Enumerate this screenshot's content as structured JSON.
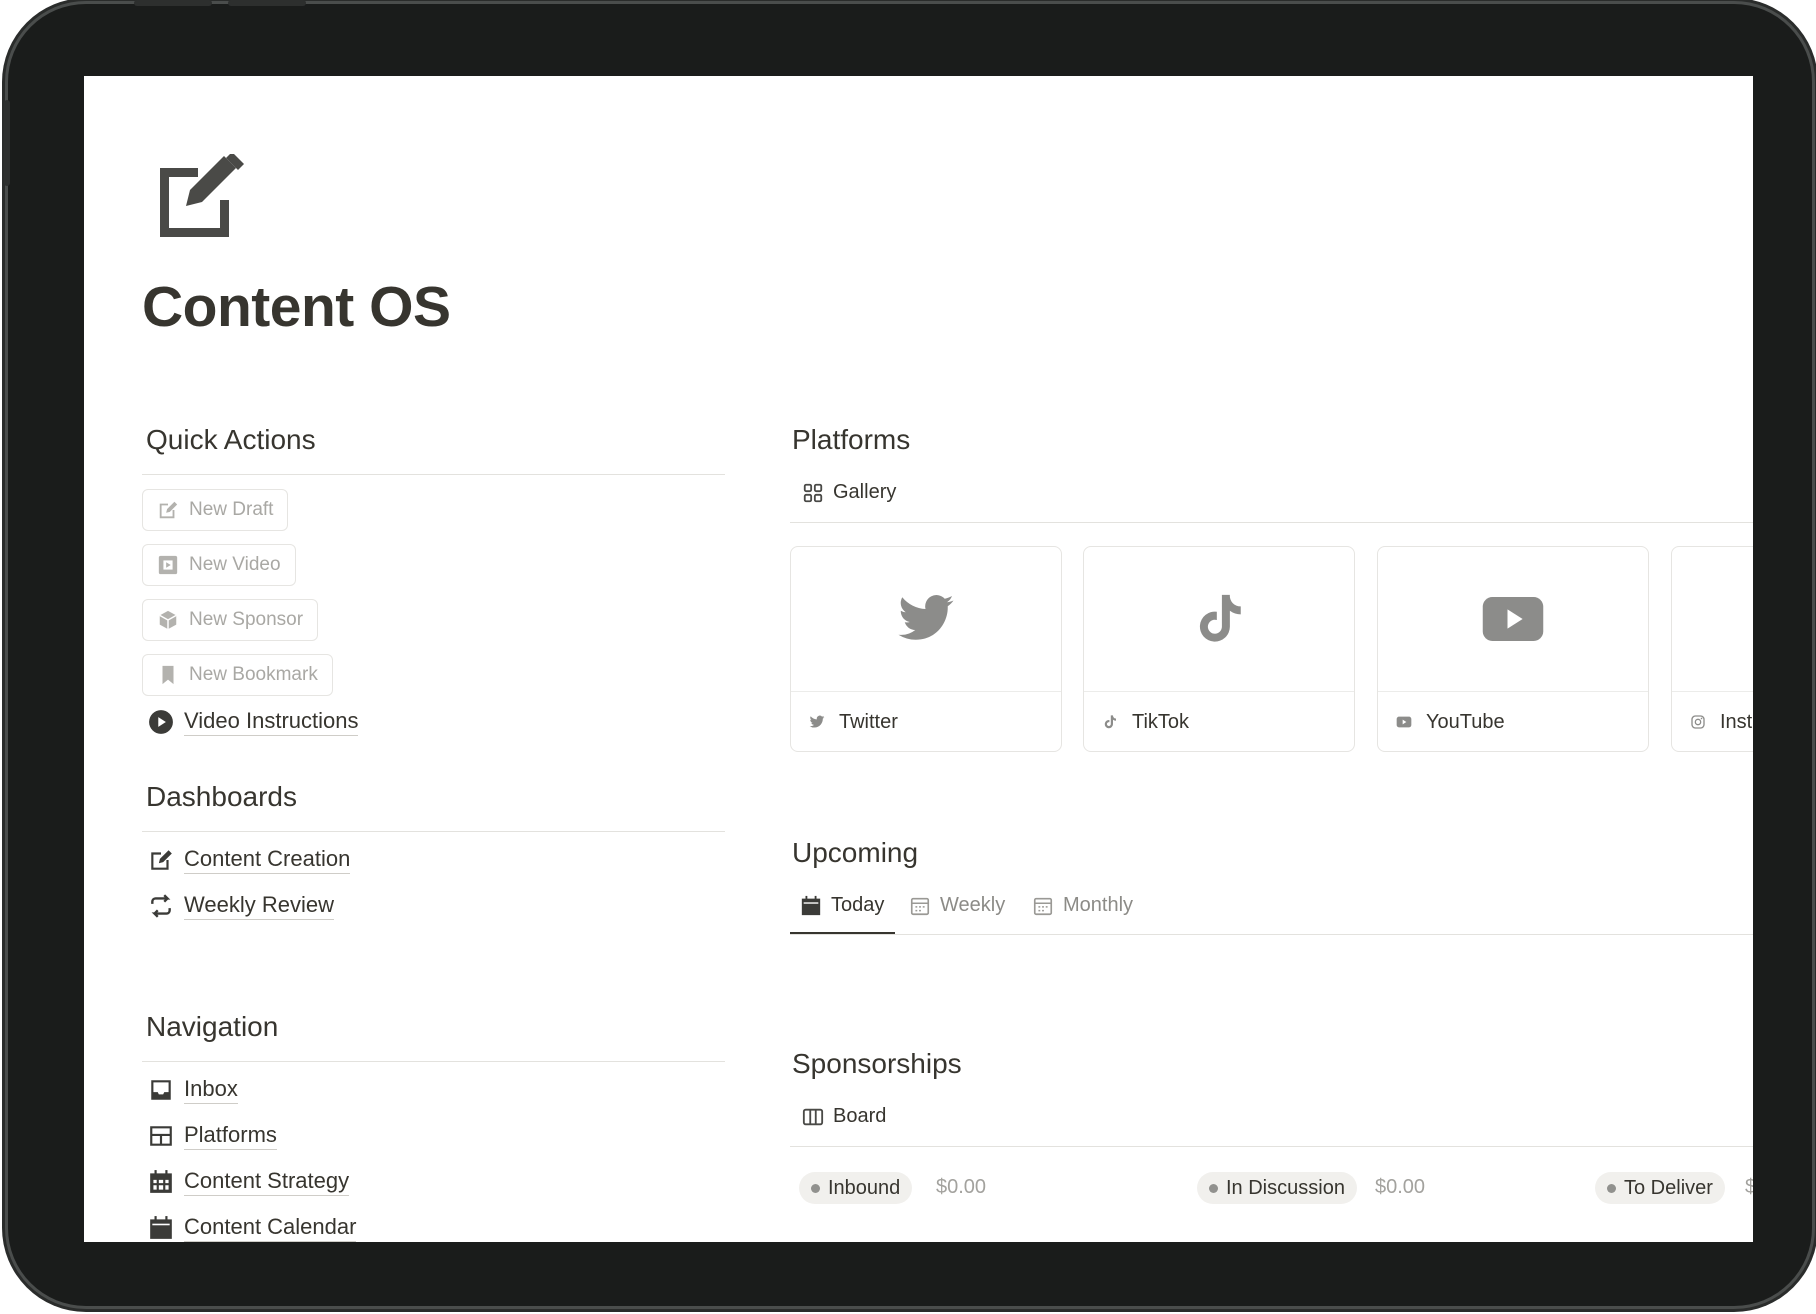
{
  "page": {
    "title": "Content OS",
    "icon": "edit-square-icon"
  },
  "quick_actions": {
    "heading": "Quick Actions",
    "buttons": [
      {
        "label": "New Draft",
        "icon": "edit-icon"
      },
      {
        "label": "New Video",
        "icon": "film-icon"
      },
      {
        "label": "New Sponsor",
        "icon": "package-icon"
      },
      {
        "label": "New Bookmark",
        "icon": "bookmark-icon"
      }
    ],
    "video_link": {
      "label": "Video Instructions",
      "icon": "play-circle-icon"
    }
  },
  "dashboards": {
    "heading": "Dashboards",
    "items": [
      {
        "label": "Content Creation",
        "icon": "edit-icon"
      },
      {
        "label": "Weekly Review",
        "icon": "repeat-icon"
      }
    ]
  },
  "navigation": {
    "heading": "Navigation",
    "items": [
      {
        "label": "Inbox",
        "icon": "inbox-icon"
      },
      {
        "label": "Platforms",
        "icon": "layout-icon"
      },
      {
        "label": "Content Strategy",
        "icon": "calendar-grid-icon"
      },
      {
        "label": "Content Calendar",
        "icon": "calendar-icon"
      }
    ]
  },
  "platforms": {
    "heading": "Platforms",
    "view": "Gallery",
    "cards": [
      {
        "name": "Twitter",
        "icon": "twitter-icon"
      },
      {
        "name": "TikTok",
        "icon": "tiktok-icon"
      },
      {
        "name": "YouTube",
        "icon": "youtube-icon"
      },
      {
        "name": "Inst",
        "icon": "instagram-icon"
      }
    ]
  },
  "upcoming": {
    "heading": "Upcoming",
    "tabs": [
      {
        "label": "Today",
        "active": true
      },
      {
        "label": "Weekly",
        "active": false
      },
      {
        "label": "Monthly",
        "active": false
      }
    ]
  },
  "sponsorships": {
    "heading": "Sponsorships",
    "view": "Board",
    "columns": [
      {
        "status": "Inbound",
        "amount": "$0.00"
      },
      {
        "status": "In Discussion",
        "amount": "$0.00"
      },
      {
        "status": "To Deliver",
        "amount": "$"
      }
    ]
  },
  "colors": {
    "text": "#37352f",
    "muted": "#a9a8a4",
    "border": "#e3e2de",
    "frame": "#1a1c1b",
    "icon_gray": "#8c8c8a"
  }
}
